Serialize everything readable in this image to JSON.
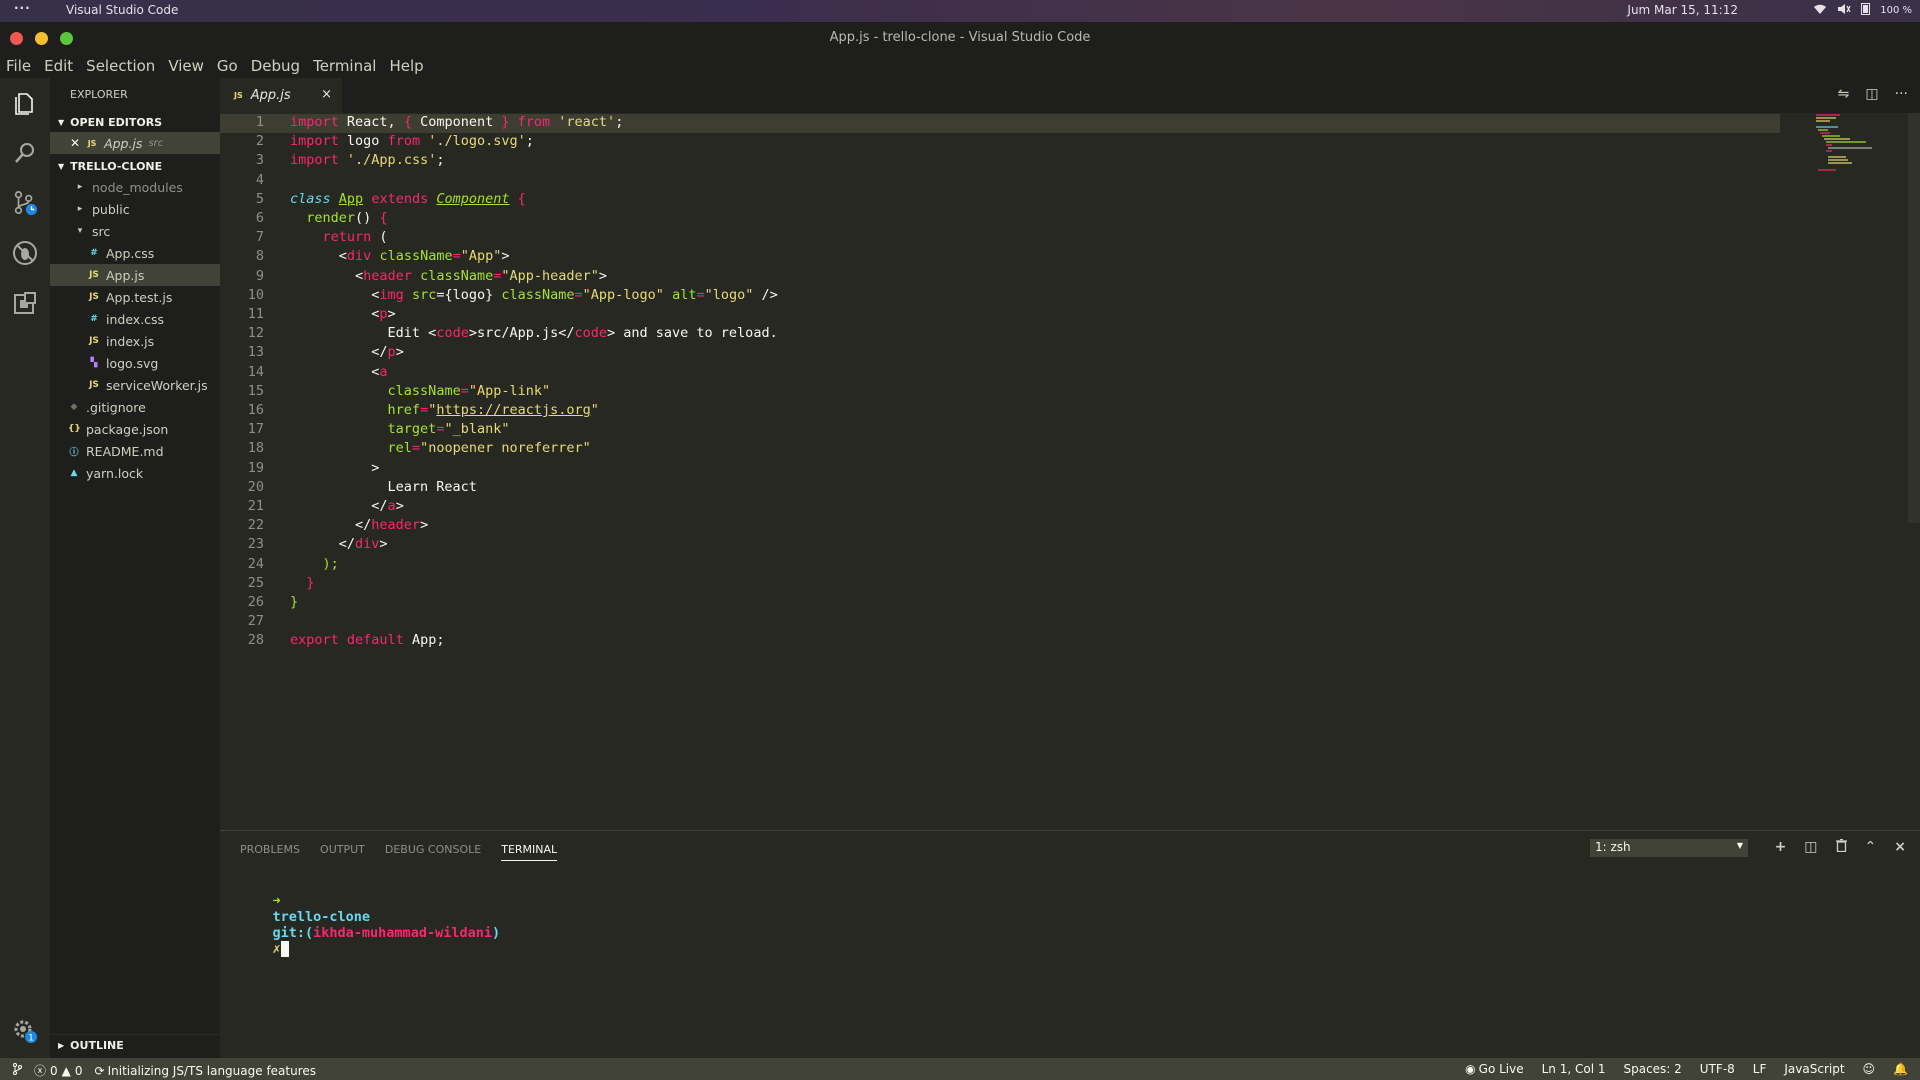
{
  "topbar": {
    "menu_dots": "···",
    "app_name": "Visual Studio Code",
    "clock": "Jum Mar 15, 11:12",
    "battery": "100 %"
  },
  "window": {
    "title": "App.js - trello-clone - Visual Studio Code"
  },
  "menu": [
    "File",
    "Edit",
    "Selection",
    "View",
    "Go",
    "Debug",
    "Terminal",
    "Help"
  ],
  "sidebar": {
    "header": "EXPLORER",
    "open_editors_label": "OPEN EDITORS",
    "open_editor": {
      "name": "App.js",
      "dir": "src",
      "badge": "JS"
    },
    "project_label": "TRELLO-CLONE",
    "tree": [
      {
        "name": "node_modules",
        "type": "folder",
        "badge": "▸"
      },
      {
        "name": "public",
        "type": "folder",
        "badge": "▸"
      },
      {
        "name": "src",
        "type": "folder-open",
        "badge": "▾"
      },
      {
        "name": "App.css",
        "type": "css",
        "badge": "#"
      },
      {
        "name": "App.js",
        "type": "js",
        "badge": "JS"
      },
      {
        "name": "App.test.js",
        "type": "js",
        "badge": "JS"
      },
      {
        "name": "index.css",
        "type": "css",
        "badge": "#"
      },
      {
        "name": "index.js",
        "type": "js",
        "badge": "JS"
      },
      {
        "name": "logo.svg",
        "type": "svg",
        "badge": "▚"
      },
      {
        "name": "serviceWorker.js",
        "type": "js",
        "badge": "JS"
      },
      {
        "name": ".gitignore",
        "type": "git",
        "badge": "◆"
      },
      {
        "name": "package.json",
        "type": "json",
        "badge": "{}"
      },
      {
        "name": "README.md",
        "type": "md",
        "badge": "ⓘ"
      },
      {
        "name": "yarn.lock",
        "type": "lock",
        "badge": "▲"
      }
    ],
    "outline_label": "OUTLINE"
  },
  "tab": {
    "badge": "JS",
    "label": "App.js",
    "close": "×"
  },
  "editor_actions": [
    "⇋",
    "◫",
    "···"
  ],
  "code": [
    "1",
    "2",
    "3",
    "4",
    "5",
    "6",
    "7",
    "8",
    "9",
    "10",
    "11",
    "12",
    "13",
    "14",
    "15",
    "16",
    "17",
    "18",
    "19",
    "20",
    "21",
    "22",
    "23",
    "24",
    "25",
    "26",
    "27",
    "28"
  ],
  "code_lines": {
    "l1": [
      "import",
      " React, ",
      "{",
      " Component ",
      "}",
      " from ",
      "'react'",
      ";"
    ],
    "l2": [
      "import",
      " logo ",
      "from",
      " ",
      "'./logo.svg'",
      ";"
    ],
    "l3": [
      "import",
      " ",
      "'./App.css'",
      ";"
    ],
    "l5": [
      "class",
      " ",
      "App",
      " ",
      "extends",
      " ",
      "Component",
      " ",
      "{"
    ],
    "l6": [
      "  ",
      "render",
      "() ",
      "{"
    ],
    "l7": [
      "    ",
      "return",
      " ("
    ],
    "l8": [
      "      <",
      "div",
      " ",
      "className",
      "=",
      "\"App\"",
      ">"
    ],
    "l9": [
      "        <",
      "header",
      " ",
      "className",
      "=",
      "\"App-header\"",
      ">"
    ],
    "l10": [
      "          <",
      "img",
      " ",
      "src",
      "={logo} ",
      "className",
      "=",
      "\"App-logo\"",
      " ",
      "alt",
      "=",
      "\"logo\"",
      " />"
    ],
    "l11": [
      "          <",
      "p",
      ">"
    ],
    "l12": [
      "            Edit <",
      "code",
      ">src/App.js</",
      "code",
      "> and save to reload."
    ],
    "l13": [
      "          </",
      "p",
      ">"
    ],
    "l14": [
      "          <",
      "a"
    ],
    "l15": [
      "            ",
      "className",
      "=",
      "\"App-link\""
    ],
    "l16": [
      "            ",
      "href",
      "=",
      "\"",
      "https://reactjs.org",
      "\""
    ],
    "l17": [
      "            ",
      "target",
      "=",
      "\"_blank\""
    ],
    "l18": [
      "            ",
      "rel",
      "=",
      "\"noopener noreferrer\""
    ],
    "l19": [
      "          >"
    ],
    "l20": [
      "            Learn React"
    ],
    "l21": [
      "          </",
      "a",
      ">"
    ],
    "l22": [
      "        </",
      "header",
      ">"
    ],
    "l23": [
      "      </",
      "div",
      ">"
    ],
    "l24": [
      "    );"
    ],
    "l25": [
      "  ",
      "}"
    ],
    "l26": [
      "}"
    ],
    "l28": [
      "export",
      " ",
      "default",
      " App;"
    ]
  },
  "panel": {
    "tabs": [
      "PROBLEMS",
      "OUTPUT",
      "DEBUG CONSOLE",
      "TERMINAL"
    ],
    "terminal_select": "1: zsh",
    "actions": [
      "+",
      "◫",
      "🗑",
      "⌃",
      "×"
    ],
    "prompt_arrow": "➜",
    "prompt_dir": "trello-clone",
    "prompt_git": "git:(",
    "prompt_branch": "ikhda-muhammad-wildani",
    "prompt_close": ")",
    "prompt_dirty": "✗"
  },
  "status": {
    "errors": "0",
    "warnings": "0",
    "message": "Initializing JS/TS language features",
    "go_live": "Go Live",
    "position": "Ln 1, Col 1",
    "spaces": "Spaces: 2",
    "encoding": "UTF-8",
    "eol": "LF",
    "language": "JavaScript"
  },
  "colors": {
    "keyword": "#f92672",
    "string": "#e6db74",
    "function": "#a6e22e",
    "class": "#66d9ef",
    "bg": "#272822"
  }
}
